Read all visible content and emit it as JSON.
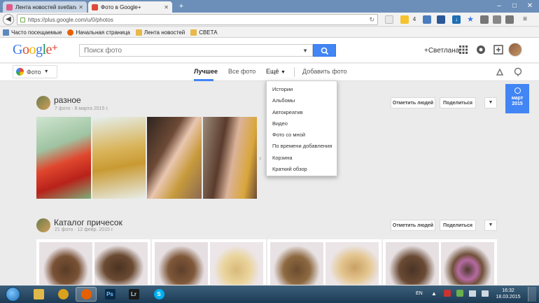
{
  "browser": {
    "tabs": [
      {
        "title": "Лента новостей svetlana2..."
      },
      {
        "title": "Фото в Google+"
      }
    ],
    "url": "https://plus.google.com/u/0/photos",
    "bookmarks": [
      {
        "label": "Часто посещаемые"
      },
      {
        "label": "Начальная страница"
      },
      {
        "label": "Лента новостей"
      },
      {
        "label": "СВЕТА"
      }
    ],
    "ext_count": "4"
  },
  "header": {
    "search_placeholder": "Поиск фото",
    "username": "+Светлана"
  },
  "subnav": {
    "photo_selector": "Фото",
    "tabs": [
      {
        "label": "Лучшее"
      },
      {
        "label": "Все фото"
      },
      {
        "label": "Ещё"
      },
      {
        "label": "Добавить фото"
      }
    ]
  },
  "more_menu": {
    "items": [
      {
        "label": "Истории"
      },
      {
        "label": "Альбомы"
      },
      {
        "label": "Автокреатив"
      },
      {
        "label": "Видео"
      },
      {
        "label": "Фото со мной"
      },
      {
        "label": "По времени добавления"
      },
      {
        "label": "Корзина"
      },
      {
        "label": "Краткий обзор"
      }
    ]
  },
  "albums": [
    {
      "title": "разное",
      "meta": "7 фото · 8 марта 2015 г.",
      "tag_label": "Отметить людей",
      "share_label": "Поделиться"
    },
    {
      "title": "Каталог причесок",
      "meta": "21 фото · 12 февр. 2015 г.",
      "tag_label": "Отметить людей",
      "share_label": "Поделиться"
    }
  ],
  "date_badge": {
    "month": "март",
    "year": "2015"
  },
  "taskbar": {
    "lang": "EN",
    "time": "16:32",
    "date": "18.03.2015"
  }
}
